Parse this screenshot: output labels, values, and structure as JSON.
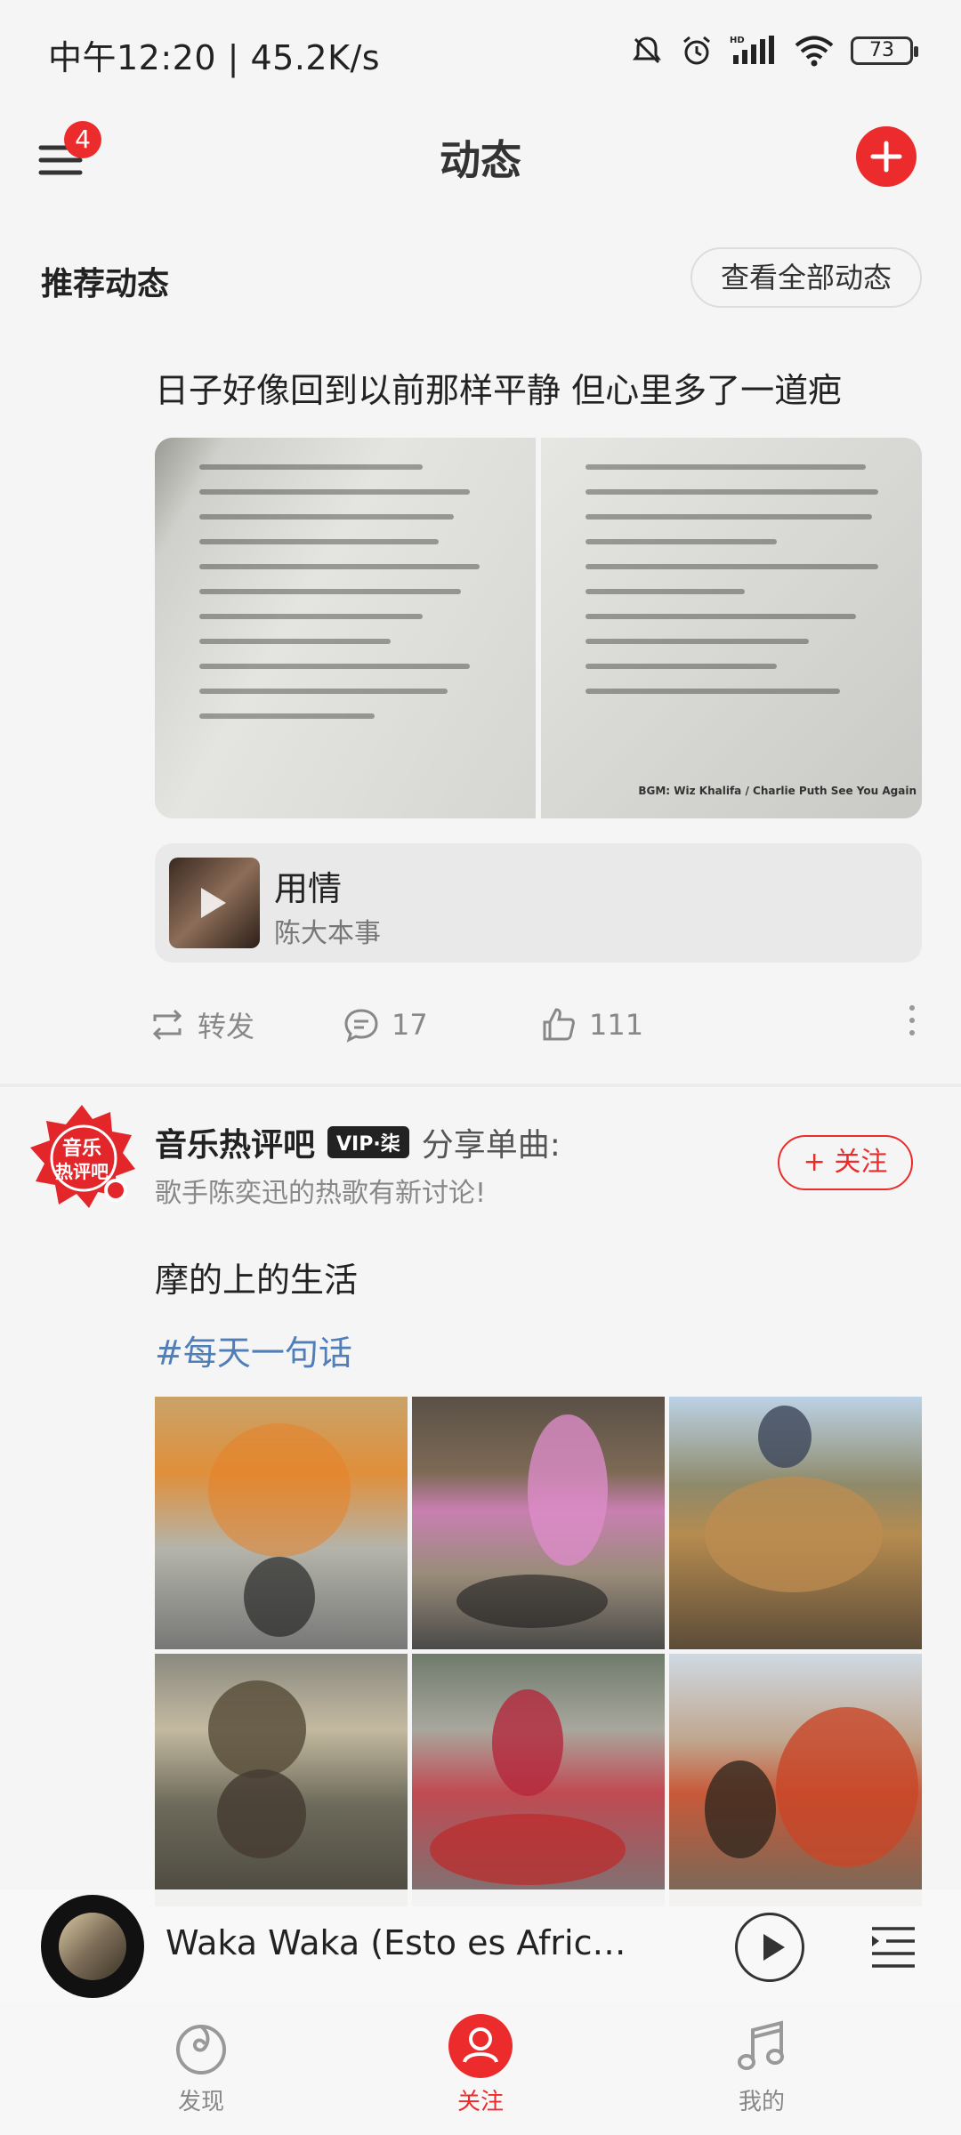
{
  "status_bar": {
    "time_speed": "中午12:20 | 45.2K/s",
    "battery": "73"
  },
  "header": {
    "title": "动态",
    "menu_badge": "4"
  },
  "recommend": {
    "title": "推荐动态",
    "view_all": "查看全部动态"
  },
  "post1": {
    "text": "日子好像回到以前那样平静 但心里多了一道疤",
    "bgm": "BGM: Wiz Khalifa / Charlie Puth See You Again",
    "song": {
      "name": "用情",
      "artist": "陈大本事"
    },
    "actions": {
      "repost": "转发",
      "comments": "17",
      "likes": "111"
    }
  },
  "post2": {
    "author": "音乐热评吧",
    "vip": "VIP·柒",
    "share_label": "分享单曲:",
    "subtitle": "歌手陈奕迅的热歌有新讨论!",
    "follow": "+ 关注",
    "text": "摩的上的生活",
    "hashtag": "#每天一句话"
  },
  "player": {
    "title": "Waka Waka (Esto es Africa) (..."
  },
  "nav": {
    "discover": "发现",
    "follow": "关注",
    "mine": "我的"
  },
  "colors": {
    "accent": "#ec2c2c",
    "hashtag": "#4f7eb8"
  }
}
